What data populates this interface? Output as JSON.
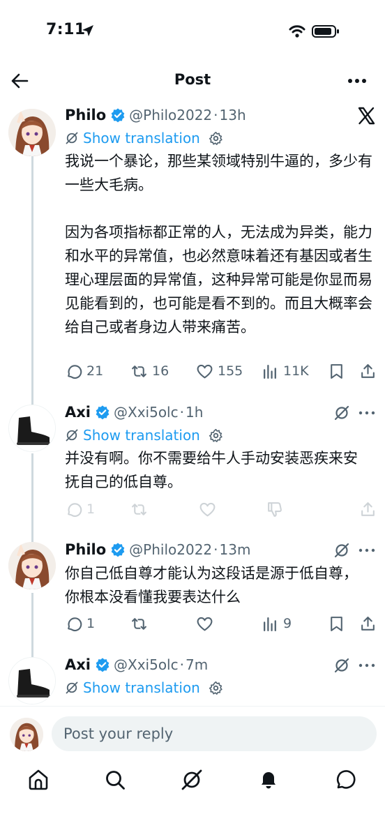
{
  "status_bar": {
    "time": "7:11"
  },
  "header": {
    "title": "Post"
  },
  "translate_label": "Show translation",
  "tweets": [
    {
      "name": "Philo",
      "handle": "@Philo2022",
      "time": "13h",
      "text": "我说一个暴论，那些某领域特别牛逼的，多少有一些大毛病。\n\n因为各项指标都正常的人，无法成为异类，能力和水平的异常值，也必然意味着还有基因或者生理心理层面的异常值，这种异常可能是你显而易见能看到的，也可能是看不到的。而且大概率会给自己或者身边人带来痛苦。",
      "stats": {
        "replies": "21",
        "reposts": "16",
        "likes": "155",
        "views": "11K"
      }
    },
    {
      "name": "Axi",
      "handle": "@Xxi5olc",
      "time": "1h",
      "text": "并没有啊。你不需要给牛人手动安装恶疾来安抚自己的低自尊。",
      "stats": {
        "replies": "1"
      }
    },
    {
      "name": "Philo",
      "handle": "@Philo2022",
      "time": "13m",
      "text": "你自己低自尊才能认为这段话是源于低自尊，你根本没看懂我要表达什么",
      "stats": {
        "replies": "1",
        "views": "9"
      }
    },
    {
      "name": "Axi",
      "handle": "@Xxi5olc",
      "time": "7m"
    }
  ],
  "reply_bar": {
    "placeholder": "Post your reply"
  },
  "colors": {
    "accent": "#1d9bf0",
    "text": "#0f1419",
    "secondary": "#536471",
    "divider": "#cfd9de"
  },
  "icons": {
    "header": [
      "back-arrow-icon",
      "more-horizontal-icon"
    ],
    "tweet_actions": [
      "reply-icon",
      "repost-icon",
      "like-icon",
      "views-icon",
      "bookmark-icon",
      "share-icon"
    ],
    "tab_bar": [
      "home-icon",
      "search-icon",
      "grok-icon",
      "notifications-icon",
      "messages-icon"
    ]
  }
}
